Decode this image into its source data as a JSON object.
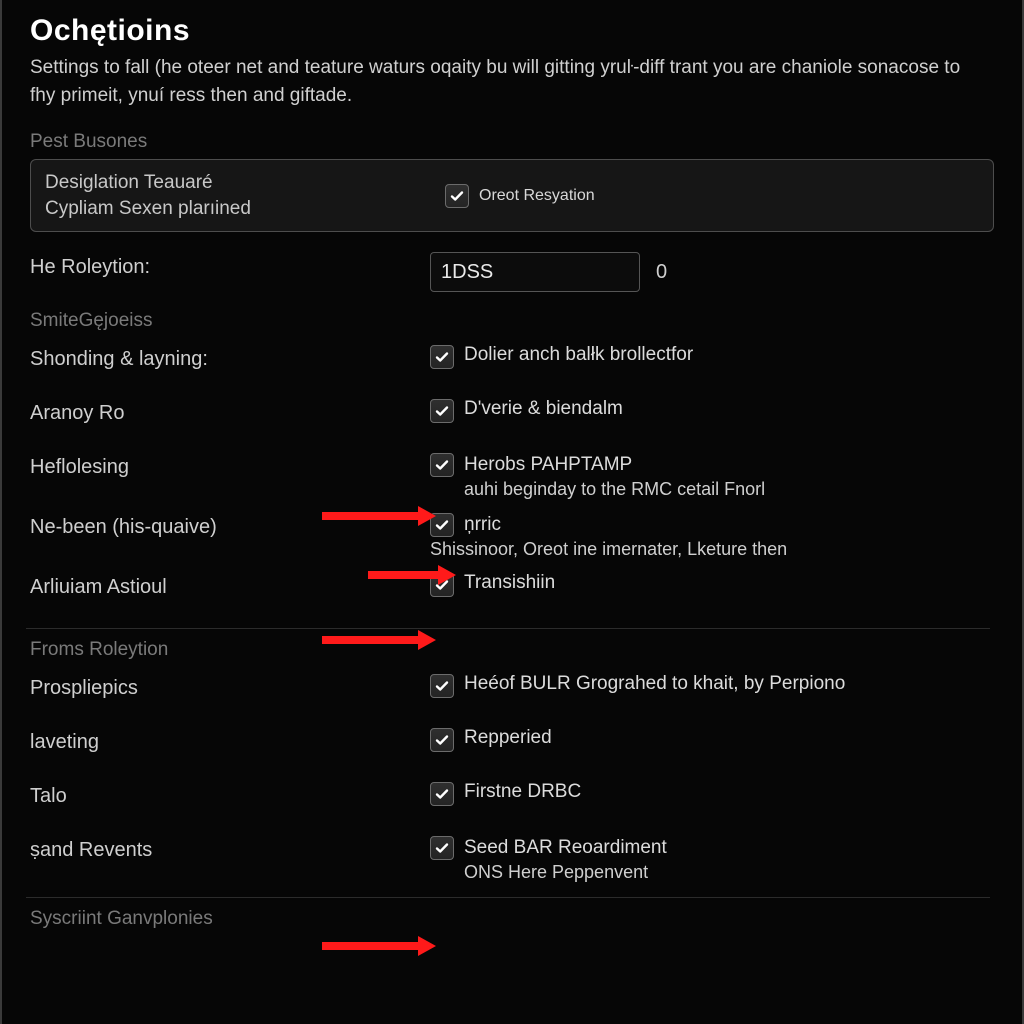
{
  "header": {
    "title": "Ochętioins",
    "subtitle": "Settings to fall (he oteer net and teature waturs oqaity bu will gitting yruŀ-diff trant you are chaniole sonacose to fhy primeit, ynuí ress then and giftade."
  },
  "section1": {
    "label": "Pest Busones",
    "box_left_line1": "Desiglation Teauaré",
    "box_left_line2": "Cypliam Sexen plarıined",
    "box_check_label": "Oreot Resyation",
    "roleytion_label": "He Roleytion:",
    "roleytion_value": "1DSS",
    "roleytion_suffix": "0"
  },
  "section2": {
    "label": "SmiteGęjoeiss",
    "rows": [
      {
        "left": "Shonding & layning:",
        "check_label": "Dolier anch balłk brollectfor"
      },
      {
        "left": "Aranoy Ro",
        "check_label": "D'verie & biendalm"
      },
      {
        "left": "Heflolesing",
        "check_label": "Herobs  PAHPTAMP",
        "sub": "auhi beginday to the RMC cetail Fnorl"
      },
      {
        "left": "Ne-been (his-quaive)",
        "check_label": "ņrric",
        "sub": "Shissinoor, Oreot ine imernater, Lketure then"
      },
      {
        "left": "Arliuiam Astioul",
        "check_label": "Transishiin"
      }
    ]
  },
  "section3": {
    "label": "Froms Roleytion",
    "rows": [
      {
        "left": "Prospliepics",
        "check_label": "Heéof BULR Grograhed to khait, by Perpiono"
      },
      {
        "left": "laveting",
        "check_label": "Repperied"
      },
      {
        "left": "Talo",
        "check_label": "Firstne DRBC"
      },
      {
        "left": "ṣand Revents",
        "check_label": "Seed BAR Reoardiment",
        "sub2": "ONS Here Peppenvent"
      }
    ]
  },
  "section4": {
    "label": "Syscriint Ganvplonies"
  }
}
